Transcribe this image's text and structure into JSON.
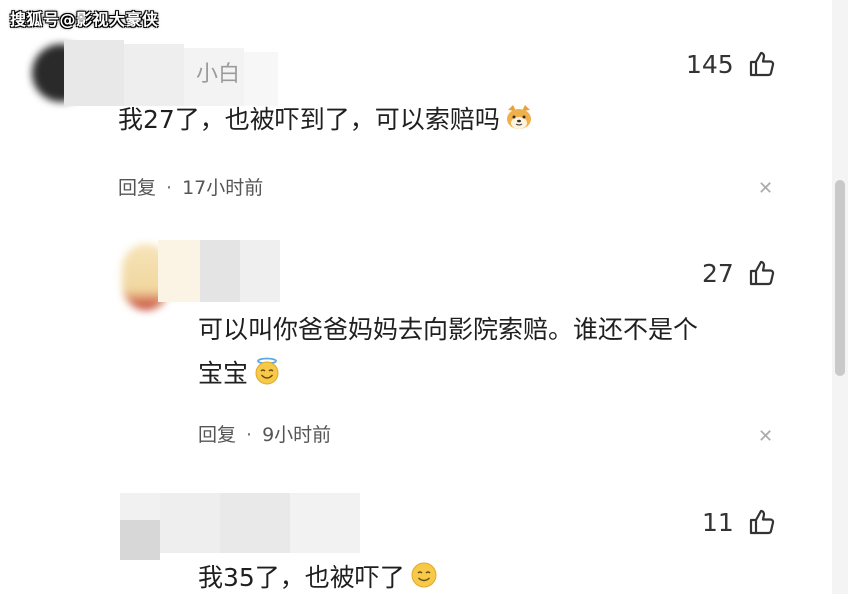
{
  "watermark": "搜狐号@影视大豪侠",
  "comments": [
    {
      "username_fragment": "小白",
      "likes": "145",
      "text": "我27了，也被吓到了，可以索赔吗",
      "emoji": "shiba-dog-emoji",
      "reply_label": "回复",
      "separator": "·",
      "time": "17小时前"
    },
    {
      "likes": "27",
      "text_line1": "可以叫你爸爸妈妈去向影院索赔。谁还不是个",
      "text_line2": "宝宝",
      "emoji": "angel-smile-emoji",
      "reply_label": "回复",
      "separator": "·",
      "time": "9小时前"
    },
    {
      "likes": "11",
      "text": "我35了，也被吓了",
      "emoji": "smile-emoji"
    }
  ],
  "icons": {
    "like": "thumbs-up-icon",
    "close": "close-icon"
  }
}
